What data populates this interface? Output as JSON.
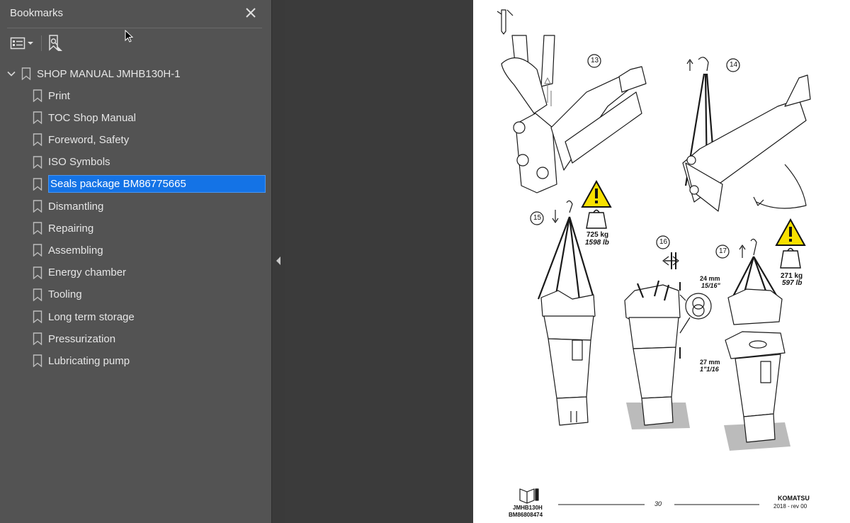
{
  "panel": {
    "title": "Bookmarks",
    "close_icon": "close-icon",
    "toolbar": {
      "options_icon": "bookmark-options-icon",
      "new_bookmark_icon": "new-bookmark-icon"
    }
  },
  "bookmarks": {
    "root": "SHOP MANUAL JMHB130H-1",
    "items": [
      "Print",
      "TOC Shop Manual",
      "Foreword, Safety",
      "ISO Symbols",
      "Seals package BM86775665",
      "Dismantling",
      "Repairing",
      "Assembling",
      "Energy chamber",
      "Tooling",
      "Long term storage",
      "Pressurization",
      "Lubricating pump"
    ],
    "selected_index": 4
  },
  "page": {
    "steps": [
      "13",
      "14",
      "15",
      "16",
      "17"
    ],
    "weight1_kg": "725 kg",
    "weight1_lb": "1598 lb",
    "weight2_kg": "271 kg",
    "weight2_lb": "597 lb",
    "wrench1_mm": "24 mm",
    "wrench1_in": "15/16\"",
    "wrench2_mm": "27 mm",
    "wrench2_in": "1\"1/16",
    "footer_model": "JMHB130H",
    "footer_code": "BM86808474",
    "page_number": "30",
    "brand": "KOMATSU",
    "revision": "2018 -  rev 00"
  },
  "colors": {
    "panel_bg": "#535353",
    "selection": "#1473e6",
    "warning_yellow": "#f7e000"
  }
}
